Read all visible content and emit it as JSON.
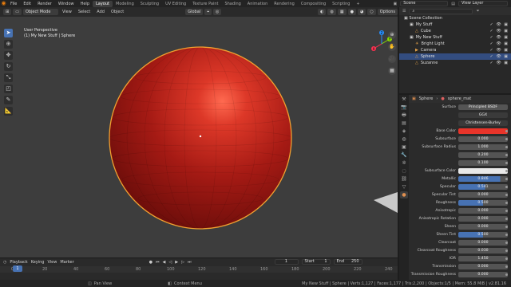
{
  "topbar": {
    "menus": [
      "File",
      "Edit",
      "Render",
      "Window",
      "Help"
    ],
    "workspaces": [
      "Layout",
      "Modeling",
      "Sculpting",
      "UV Editing",
      "Texture Paint",
      "Shading",
      "Animation",
      "Rendering",
      "Compositing",
      "Scripting"
    ],
    "active_workspace": "Layout",
    "scene": "Scene",
    "view_layer": "View Layer"
  },
  "viewport": {
    "mode": "Object Mode",
    "menus": [
      "View",
      "Select",
      "Add",
      "Object"
    ],
    "transform": "Global",
    "options": "Options",
    "info_line1": "User Perspective",
    "info_line2": "(1) My New Stuff | Sphere",
    "gizmo": {
      "y": "Y",
      "x": "X",
      "z": "Z"
    }
  },
  "timeline": {
    "menus": [
      "Playback",
      "Keying",
      "View",
      "Marker"
    ],
    "current_frame": "1",
    "start_label": "Start",
    "start": "1",
    "end_label": "End",
    "end": "250",
    "ticks": [
      "0",
      "20",
      "40",
      "60",
      "80",
      "100",
      "120",
      "140",
      "160",
      "180",
      "200",
      "220",
      "240"
    ]
  },
  "statusbar": {
    "pan": "Pan View",
    "context": "Context Menu",
    "stats": "My New Stuff | Sphere | Verts:1,127 | Faces:1,177 | Tris:2,200 | Objects:1/5 | Mem: 55.8 MiB | v2.81.16"
  },
  "outliner": {
    "title": "Scene Collection",
    "items": [
      {
        "name": "My Stuff",
        "indent": 1
      },
      {
        "name": "Cube",
        "indent": 2
      },
      {
        "name": "My New Stuff",
        "indent": 1
      },
      {
        "name": "Bright Light",
        "indent": 2
      },
      {
        "name": "Camera",
        "indent": 2
      },
      {
        "name": "Sphere",
        "indent": 2,
        "selected": true
      },
      {
        "name": "Suzanne",
        "indent": 2
      }
    ]
  },
  "properties": {
    "object": "Sphere",
    "material": "sphere_mat",
    "surface_label": "Surface",
    "surface_value": "Principled BSDF",
    "distribution": "GGX",
    "subsurface_method": "Christensen-Burley",
    "rows": [
      {
        "label": "Base Color",
        "value": "",
        "kind": "color-red"
      },
      {
        "label": "Subsurface",
        "value": "0.000"
      },
      {
        "label": "Subsurface Radius",
        "value": "1.000"
      },
      {
        "label": "",
        "value": "0.200"
      },
      {
        "label": "",
        "value": "0.100"
      },
      {
        "label": "Subsurface Color",
        "value": "",
        "kind": "color-white"
      },
      {
        "label": "Metallic",
        "value": "0.846",
        "kind": "blue"
      },
      {
        "label": "Specular",
        "value": "0.541",
        "kind": "blue"
      },
      {
        "label": "Specular Tint",
        "value": "0.000"
      },
      {
        "label": "Roughness",
        "value": "0.500",
        "kind": "blue-half"
      },
      {
        "label": "Anisotropic",
        "value": "0.000"
      },
      {
        "label": "Anisotropic Rotation",
        "value": "0.000"
      },
      {
        "label": "Sheen",
        "value": "0.000"
      },
      {
        "label": "Sheen Tint",
        "value": "0.500",
        "kind": "blue-half"
      },
      {
        "label": "Clearcoat",
        "value": "0.000"
      },
      {
        "label": "Clearcoat Roughness",
        "value": "0.030"
      },
      {
        "label": "IOR",
        "value": "1.450"
      },
      {
        "label": "Transmission",
        "value": "0.000"
      },
      {
        "label": "Transmission Roughness",
        "value": "0.000"
      }
    ]
  },
  "colors": {
    "accent": "#4772b3",
    "base_color": "#e8342a",
    "sphere": "#b8201a",
    "outline": "#f0a030"
  }
}
